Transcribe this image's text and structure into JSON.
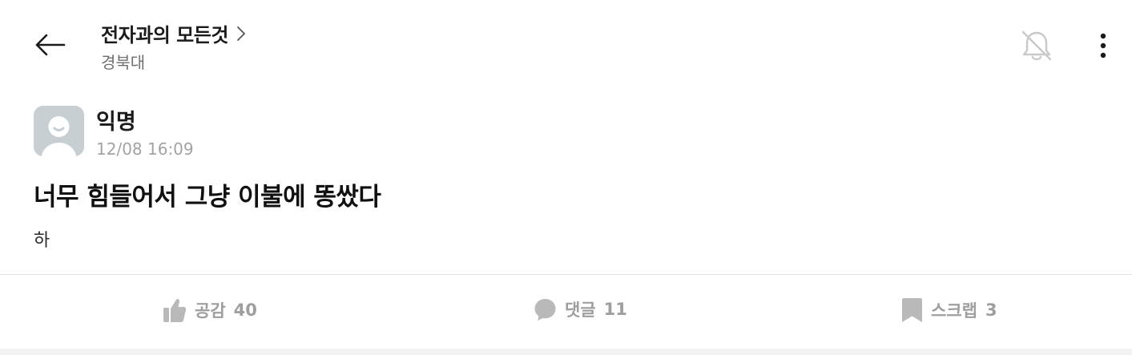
{
  "header": {
    "board_title": "전자과의 모든것",
    "board_subtitle": "경북대"
  },
  "post": {
    "author": "익명",
    "date": "12/08 16:09",
    "title": "너무 힘들어서 그냥 이불에 똥쌌다",
    "body": "하"
  },
  "actions": {
    "like_label": "공감",
    "like_count": "40",
    "comment_label": "댓글",
    "comment_count": "11",
    "scrap_label": "스크랩",
    "scrap_count": "3"
  },
  "colors": {
    "icon_gray": "#9e9e9e",
    "avatar_bg": "#c7cfd3",
    "divider": "#e3e3e3"
  }
}
